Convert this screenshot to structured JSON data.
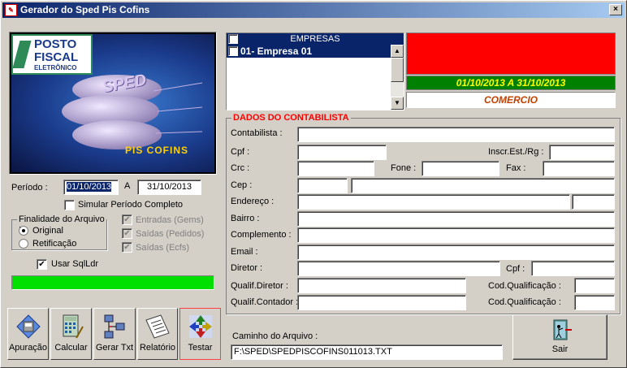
{
  "window": {
    "title": "Gerador do Sped Pis Cofins",
    "close_label": "×"
  },
  "logo": {
    "line1": "POSTO",
    "line2": "FISCAL",
    "line3": "ELETRÔNICO",
    "sped": "SPED",
    "piscofins": "PIS COFINS"
  },
  "periodo": {
    "label": "Período :",
    "from": "01/10/2013",
    "sep": "A",
    "to": "31/10/2013"
  },
  "simular": {
    "label": "Simular Período Completo",
    "checked": false
  },
  "finalidade": {
    "title": "Finalidade do Arquivo :",
    "options": [
      {
        "label": "Original",
        "selected": true
      },
      {
        "label": "Retificação",
        "selected": false
      }
    ]
  },
  "fontes": [
    {
      "label": "Entradas (Gems)",
      "checked": true
    },
    {
      "label": "Saídas (Pedidos)",
      "checked": true
    },
    {
      "label": "Saídas (Ecfs)",
      "checked": true
    }
  ],
  "usar_sqlldr": {
    "label": "Usar SqlLdr",
    "checked": true
  },
  "progress": {
    "value": 1.0,
    "color": "#00e000"
  },
  "empresas": {
    "header": "EMPRESAS",
    "items": [
      {
        "label": "01- Empresa 01",
        "checked": false
      }
    ]
  },
  "status": {
    "red_color": "#ff0000",
    "periodo_text": "01/10/2013 A 31/10/2013",
    "periodo_color": "#ffff00",
    "periodo_bg": "#008000",
    "atividade": "COMERCIO",
    "atividade_color": "#c04000"
  },
  "contabilista": {
    "title": "DADOS DO CONTABILISTA",
    "fields": {
      "contabilista": {
        "label": "Contabilista :",
        "value": ""
      },
      "cpf": {
        "label": "Cpf :",
        "value": ""
      },
      "inscr": {
        "label": "Inscr.Est./Rg :",
        "value": ""
      },
      "crc": {
        "label": "Crc :",
        "value": ""
      },
      "fone": {
        "label": "Fone :",
        "value": ""
      },
      "fax": {
        "label": "Fax :",
        "value": ""
      },
      "cep": {
        "label": "Cep :",
        "value": ""
      },
      "endereco": {
        "label": "Endereço :",
        "value": ""
      },
      "bairro": {
        "label": "Bairro :",
        "value": ""
      },
      "complemento": {
        "label": "Complemento :",
        "value": ""
      },
      "email": {
        "label": "Email :",
        "value": ""
      },
      "diretor": {
        "label": "Diretor :",
        "value": ""
      },
      "cpf2": {
        "label": "Cpf :",
        "value": ""
      },
      "qualif_diretor": {
        "label": "Qualif.Diretor :",
        "value": ""
      },
      "cod_qual1": {
        "label": "Cod.Qualificação :",
        "value": ""
      },
      "qualif_contador": {
        "label": "Qualif.Contador :",
        "value": ""
      },
      "cod_qual2": {
        "label": "Cod.Qualificação :",
        "value": ""
      }
    }
  },
  "toolbar": {
    "apuracao": "Apuração",
    "calcular": "Calcular",
    "gerar_txt": "Gerar Txt",
    "relatorio": "Relatório",
    "testar": "Testar"
  },
  "caminho": {
    "label": "Caminho do Arquivo :",
    "value": "F:\\SPED\\SPEDPISCOFINS011013.TXT"
  },
  "sair": {
    "label": "Sair"
  }
}
